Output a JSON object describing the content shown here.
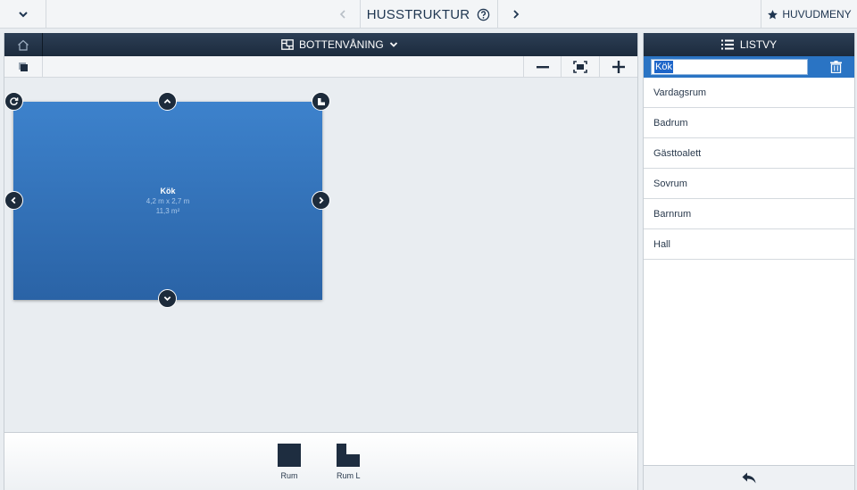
{
  "topbar": {
    "title": "HUSSTRUKTUR",
    "menu_label": "HUVUDMENY",
    "icons": [
      "chevron-down-icon",
      "chevron-left-icon",
      "help-icon",
      "chevron-right-icon",
      "star-icon"
    ]
  },
  "floorplan": {
    "floor_label": "BOTTENVÅNING",
    "room": {
      "name": "Kök",
      "dimensions": "4,2 m x 2,7 m",
      "area": "11,3 m²"
    }
  },
  "palette": {
    "items": [
      {
        "label": "Rum",
        "icon": "room-shape-icon"
      },
      {
        "label": "Rum L",
        "icon": "l-room-shape-icon"
      }
    ]
  },
  "listview": {
    "title": "LISTVY",
    "search_value": "Kök",
    "items": [
      "Vardagsrum",
      "Badrum",
      "Gästtoalett",
      "Sovrum",
      "Barnrum",
      "Hall"
    ]
  },
  "colors": {
    "header_dark": "#1c2b3d",
    "room_blue": "#3d82cc",
    "accent_blue": "#2a74c4"
  }
}
